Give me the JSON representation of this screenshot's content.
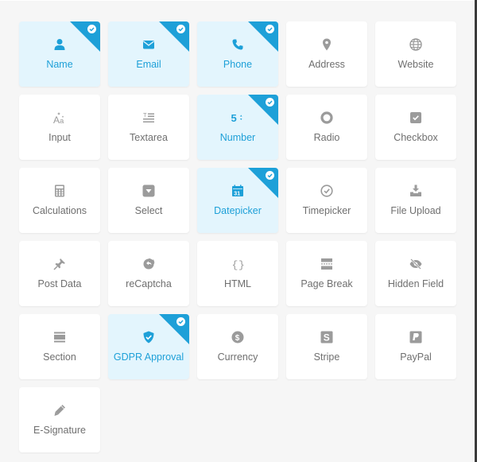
{
  "colors": {
    "selected_bg": "#e3f5fd",
    "accent": "#1ea0d8",
    "icon_gray": "#9b9b9b",
    "label_gray": "#6f6f6f",
    "page_bg": "#f6f6f6"
  },
  "fields": [
    {
      "label": "Name",
      "icon": "user-icon",
      "selected": true
    },
    {
      "label": "Email",
      "icon": "envelope-icon",
      "selected": true
    },
    {
      "label": "Phone",
      "icon": "phone-icon",
      "selected": true
    },
    {
      "label": "Address",
      "icon": "map-marker-icon",
      "selected": false
    },
    {
      "label": "Website",
      "icon": "globe-icon",
      "selected": false
    },
    {
      "label": "Input",
      "icon": "text-input-icon",
      "selected": false
    },
    {
      "label": "Textarea",
      "icon": "textarea-icon",
      "selected": false
    },
    {
      "label": "Number",
      "icon": "number-icon",
      "selected": true
    },
    {
      "label": "Radio",
      "icon": "radio-icon",
      "selected": false
    },
    {
      "label": "Checkbox",
      "icon": "checkbox-icon",
      "selected": false
    },
    {
      "label": "Calculations",
      "icon": "calculator-icon",
      "selected": false
    },
    {
      "label": "Select",
      "icon": "select-dropdown-icon",
      "selected": false
    },
    {
      "label": "Datepicker",
      "icon": "calendar-icon",
      "selected": true
    },
    {
      "label": "Timepicker",
      "icon": "clock-icon",
      "selected": false
    },
    {
      "label": "File Upload",
      "icon": "upload-icon",
      "selected": false
    },
    {
      "label": "Post Data",
      "icon": "pin-icon",
      "selected": false
    },
    {
      "label": "reCaptcha",
      "icon": "recaptcha-icon",
      "selected": false
    },
    {
      "label": "HTML",
      "icon": "code-braces-icon",
      "selected": false
    },
    {
      "label": "Page Break",
      "icon": "page-break-icon",
      "selected": false
    },
    {
      "label": "Hidden Field",
      "icon": "eye-slash-icon",
      "selected": false
    },
    {
      "label": "Section",
      "icon": "section-icon",
      "selected": false
    },
    {
      "label": "GDPR Approval",
      "icon": "shield-check-icon",
      "selected": true
    },
    {
      "label": "Currency",
      "icon": "dollar-circle-icon",
      "selected": false
    },
    {
      "label": "Stripe",
      "icon": "stripe-icon",
      "selected": false
    },
    {
      "label": "PayPal",
      "icon": "paypal-icon",
      "selected": false
    },
    {
      "label": "E-Signature",
      "icon": "pencil-icon",
      "selected": false
    }
  ]
}
